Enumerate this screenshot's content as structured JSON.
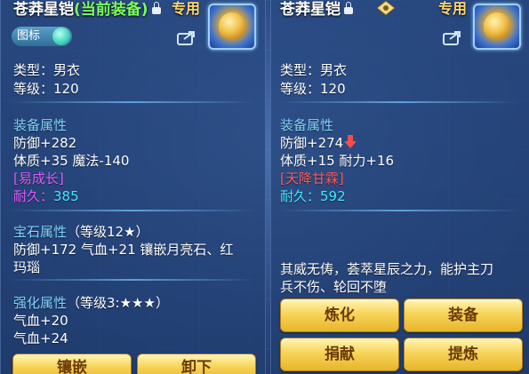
{
  "left_panel": {
    "title": "苍莽星铠",
    "title_status": "(当前装备)",
    "exclusive_label": "专用",
    "tag_button_label": "图标",
    "type_line": "类型：男衣",
    "level_line": "等级：120",
    "equip_attr_header": "装备属性",
    "defense_line": "防御+282",
    "stats_line": "体质+35 魔法-140",
    "special_tag": "[易成长]",
    "durability_label": "耐久：",
    "durability_value": "385",
    "gem_header": "宝石属性",
    "gem_level": "（等级12★）",
    "gem_line1": "防御+172 气血+21 镶嵌月亮石、红",
    "gem_line2": "玛瑙",
    "enhance_header": "强化属性",
    "enhance_level": "（等级3:★★★）",
    "enhance_line1": "气血+20",
    "enhance_line2": "气血+24",
    "buttons": [
      "镶嵌",
      "卸下"
    ]
  },
  "right_panel": {
    "title": "苍莽星铠",
    "exclusive_label": "专用",
    "type_line": "类型：男衣",
    "level_line": "等级：120",
    "equip_attr_header": "装备属性",
    "defense_line": "防御+274",
    "stats_line": "体质+15 耐力+16",
    "special_tag": "[天降甘霖]",
    "durability_label": "耐久：",
    "durability_value": "592",
    "description_line1": "其威无俦，荟萃星辰之力，能护主刀",
    "description_line2": "兵不伤、轮回不堕",
    "buttons": [
      "炼化",
      "装备",
      "捐献",
      "提炼"
    ]
  },
  "colors": {
    "panel_bg": "#2a4a85",
    "section_header": "#7fd4ff",
    "cyan_value": "#44e9ff",
    "purple_tag": "#e25bff",
    "red_tag": "#ff5a5a",
    "equipped_green": "#7cff5a",
    "button_gold": "#f7d45a"
  },
  "icons": [
    "lock-icon",
    "share-icon",
    "armor-item-icon",
    "badge-icon",
    "down-arrow-icon"
  ]
}
